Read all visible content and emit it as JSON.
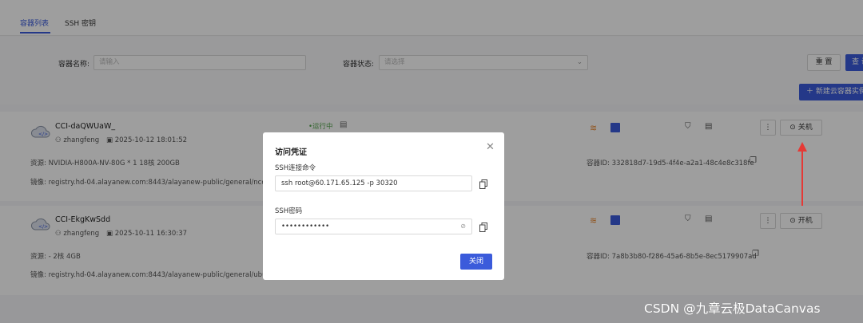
{
  "tabs": [
    {
      "label": "容器列表"
    },
    {
      "label": "SSH 密钥"
    }
  ],
  "filters": {
    "name_label": "容器名称:",
    "name_placeholder": "请输入",
    "status_label": "容器状态:",
    "status_placeholder": "请选择",
    "reset_label": "重 置",
    "query_label": "查 询"
  },
  "new_button": "新建云容器实例",
  "containers": [
    {
      "name": "CCI-daQWUaW_",
      "user": "zhangfeng",
      "created": "2025-10-12 18:01:52",
      "status": "运行中",
      "resources": "资源:  NVIDIA-H800A-NV-80G  * 1    18核  200GB",
      "image": "镜像:  registry.hd-04.alayanew.com:8443/alayanew-public/general/nccl-tes",
      "container_id": "容器ID:  332818d7-19d5-4f4e-a2a1-48c4e8c318fe",
      "action": "关机"
    },
    {
      "name": "CCI-EkgKwSdd",
      "user": "zhangfeng",
      "created": "2025-10-11 16:30:37",
      "status": "",
      "resources": "资源:  -   2核  4GB",
      "image": "镜像:  registry.hd-04.alayanew.com:8443/alayanew-public/general/ubuntu",
      "container_id": "容器ID:  7a8b3b80-f286-45a6-8b5e-8ec5179907ad",
      "action": "开机"
    }
  ],
  "modal": {
    "title": "访问凭证",
    "ssh_cmd_label": "SSH连接命令",
    "ssh_cmd_value": "ssh root@60.171.65.125 -p 30320",
    "ssh_pwd_label": "SSH密码",
    "ssh_pwd_value": "••••••••••••",
    "close_button": "关闭"
  },
  "watermark": "CSDN @九章云极DataCanvas",
  "colors": {
    "primary": "#3b5bdb",
    "status_green": "#52a34c",
    "annotation_red": "#e53935"
  }
}
